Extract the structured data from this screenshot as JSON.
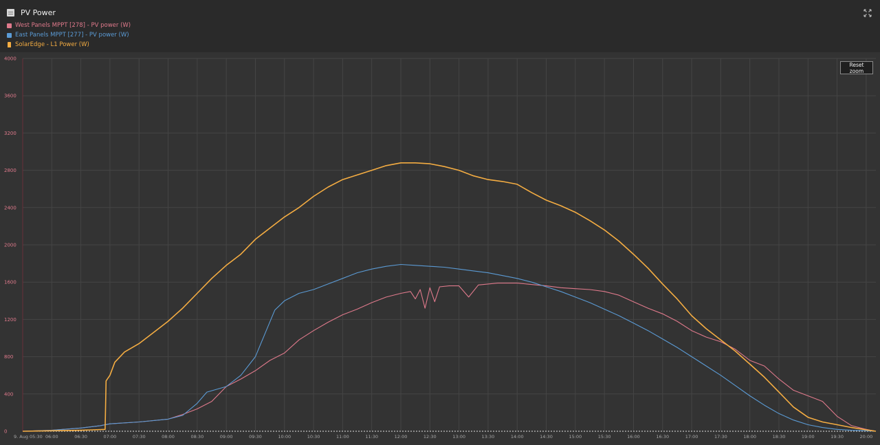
{
  "window": {
    "title": "PV Power",
    "title_icon": "chart-widget-icon",
    "expand_icon": "expand-icon"
  },
  "legend": [
    {
      "label": "West Panels MPPT [278] - PV power (W)",
      "color": "#e07a8c",
      "icon": "square"
    },
    {
      "label": "East Panels MPPT [277] - PV power (W)",
      "color": "#5b9bd5",
      "icon": "square"
    },
    {
      "label": "SolarEdge - L1 Power (W)",
      "color": "#f5ad42",
      "icon": "bottle"
    }
  ],
  "reset_zoom_label": "Reset zoom",
  "chart_data": {
    "type": "line",
    "title": "PV Power",
    "xlabel": "",
    "ylabel": "",
    "x_ticks": [
      "9. Aug 05:30",
      "06:00",
      "06:30",
      "07:00",
      "07:30",
      "08:00",
      "08:30",
      "09:00",
      "09:30",
      "10:00",
      "10:30",
      "11:00",
      "11:30",
      "12:00",
      "12:30",
      "13:00",
      "13:30",
      "14:00",
      "14:30",
      "15:00",
      "15:30",
      "16:00",
      "16:30",
      "17:00",
      "17:30",
      "18:00",
      "18:30",
      "19:00",
      "19:30",
      "20:00"
    ],
    "xlim": [
      "05:30",
      "20:10"
    ],
    "y_ticks": [
      0,
      400,
      800,
      1200,
      1600,
      2000,
      2400,
      2800,
      3200,
      3600,
      4000
    ],
    "ylim": [
      0,
      4000
    ],
    "grid": true,
    "series": [
      {
        "name": "West Panels MPPT [278] - PV power (W)",
        "color": "#e07a8c",
        "points": [
          [
            "05:30",
            0
          ],
          [
            "06:00",
            10
          ],
          [
            "06:30",
            35
          ],
          [
            "06:50",
            60
          ],
          [
            "07:00",
            80
          ],
          [
            "07:30",
            100
          ],
          [
            "08:00",
            130
          ],
          [
            "08:15",
            180
          ],
          [
            "08:30",
            240
          ],
          [
            "08:45",
            320
          ],
          [
            "09:00",
            480
          ],
          [
            "09:15",
            560
          ],
          [
            "09:30",
            650
          ],
          [
            "09:45",
            760
          ],
          [
            "10:00",
            840
          ],
          [
            "10:15",
            980
          ],
          [
            "10:30",
            1080
          ],
          [
            "10:45",
            1170
          ],
          [
            "11:00",
            1250
          ],
          [
            "11:15",
            1310
          ],
          [
            "11:30",
            1380
          ],
          [
            "11:45",
            1440
          ],
          [
            "12:00",
            1480
          ],
          [
            "12:10",
            1500
          ],
          [
            "12:15",
            1420
          ],
          [
            "12:20",
            1520
          ],
          [
            "12:25",
            1320
          ],
          [
            "12:30",
            1540
          ],
          [
            "12:35",
            1390
          ],
          [
            "12:40",
            1550
          ],
          [
            "12:50",
            1560
          ],
          [
            "13:00",
            1560
          ],
          [
            "13:10",
            1440
          ],
          [
            "13:20",
            1570
          ],
          [
            "13:30",
            1580
          ],
          [
            "13:40",
            1590
          ],
          [
            "13:50",
            1590
          ],
          [
            "14:00",
            1590
          ],
          [
            "14:10",
            1580
          ],
          [
            "14:20",
            1570
          ],
          [
            "14:30",
            1560
          ],
          [
            "14:45",
            1540
          ],
          [
            "15:00",
            1530
          ],
          [
            "15:15",
            1520
          ],
          [
            "15:30",
            1500
          ],
          [
            "15:45",
            1460
          ],
          [
            "16:00",
            1390
          ],
          [
            "16:15",
            1320
          ],
          [
            "16:30",
            1260
          ],
          [
            "16:45",
            1180
          ],
          [
            "17:00",
            1080
          ],
          [
            "17:15",
            1010
          ],
          [
            "17:30",
            960
          ],
          [
            "17:45",
            880
          ],
          [
            "18:00",
            760
          ],
          [
            "18:15",
            700
          ],
          [
            "18:30",
            560
          ],
          [
            "18:45",
            440
          ],
          [
            "19:00",
            380
          ],
          [
            "19:15",
            320
          ],
          [
            "19:30",
            160
          ],
          [
            "19:45",
            60
          ],
          [
            "20:00",
            20
          ],
          [
            "20:10",
            0
          ]
        ]
      },
      {
        "name": "East Panels MPPT [277] - PV power (W)",
        "color": "#5b9bd5",
        "points": [
          [
            "05:30",
            0
          ],
          [
            "06:00",
            10
          ],
          [
            "06:30",
            35
          ],
          [
            "06:50",
            60
          ],
          [
            "07:00",
            80
          ],
          [
            "07:30",
            100
          ],
          [
            "08:00",
            130
          ],
          [
            "08:15",
            170
          ],
          [
            "08:30",
            300
          ],
          [
            "08:40",
            420
          ],
          [
            "09:00",
            480
          ],
          [
            "09:15",
            600
          ],
          [
            "09:30",
            800
          ],
          [
            "09:40",
            1050
          ],
          [
            "09:50",
            1300
          ],
          [
            "10:00",
            1400
          ],
          [
            "10:15",
            1480
          ],
          [
            "10:30",
            1520
          ],
          [
            "10:45",
            1580
          ],
          [
            "11:00",
            1640
          ],
          [
            "11:15",
            1700
          ],
          [
            "11:30",
            1740
          ],
          [
            "11:45",
            1770
          ],
          [
            "12:00",
            1790
          ],
          [
            "12:15",
            1780
          ],
          [
            "12:30",
            1770
          ],
          [
            "12:45",
            1760
          ],
          [
            "13:00",
            1740
          ],
          [
            "13:15",
            1720
          ],
          [
            "13:30",
            1700
          ],
          [
            "13:45",
            1670
          ],
          [
            "14:00",
            1640
          ],
          [
            "14:15",
            1600
          ],
          [
            "14:30",
            1550
          ],
          [
            "14:45",
            1500
          ],
          [
            "15:00",
            1440
          ],
          [
            "15:15",
            1380
          ],
          [
            "15:30",
            1310
          ],
          [
            "15:45",
            1240
          ],
          [
            "16:00",
            1160
          ],
          [
            "16:15",
            1080
          ],
          [
            "16:30",
            990
          ],
          [
            "16:45",
            900
          ],
          [
            "17:00",
            800
          ],
          [
            "17:15",
            700
          ],
          [
            "17:30",
            600
          ],
          [
            "17:45",
            490
          ],
          [
            "18:00",
            380
          ],
          [
            "18:15",
            280
          ],
          [
            "18:30",
            190
          ],
          [
            "18:45",
            120
          ],
          [
            "19:00",
            70
          ],
          [
            "19:15",
            40
          ],
          [
            "19:30",
            20
          ],
          [
            "19:45",
            10
          ],
          [
            "20:00",
            5
          ],
          [
            "20:10",
            0
          ]
        ]
      },
      {
        "name": "SolarEdge - L1 Power (W)",
        "color": "#f5ad42",
        "points": [
          [
            "05:30",
            0
          ],
          [
            "06:00",
            5
          ],
          [
            "06:30",
            10
          ],
          [
            "06:55",
            20
          ],
          [
            "06:56",
            540
          ],
          [
            "07:00",
            600
          ],
          [
            "07:05",
            740
          ],
          [
            "07:15",
            850
          ],
          [
            "07:30",
            940
          ],
          [
            "07:45",
            1060
          ],
          [
            "08:00",
            1180
          ],
          [
            "08:15",
            1320
          ],
          [
            "08:30",
            1480
          ],
          [
            "08:45",
            1640
          ],
          [
            "09:00",
            1780
          ],
          [
            "09:15",
            1900
          ],
          [
            "09:30",
            2060
          ],
          [
            "09:45",
            2180
          ],
          [
            "10:00",
            2300
          ],
          [
            "10:15",
            2400
          ],
          [
            "10:30",
            2520
          ],
          [
            "10:45",
            2620
          ],
          [
            "11:00",
            2700
          ],
          [
            "11:15",
            2750
          ],
          [
            "11:30",
            2800
          ],
          [
            "11:45",
            2850
          ],
          [
            "12:00",
            2880
          ],
          [
            "12:15",
            2880
          ],
          [
            "12:30",
            2870
          ],
          [
            "12:45",
            2840
          ],
          [
            "13:00",
            2800
          ],
          [
            "13:15",
            2740
          ],
          [
            "13:30",
            2700
          ],
          [
            "13:45",
            2680
          ],
          [
            "14:00",
            2650
          ],
          [
            "14:15",
            2560
          ],
          [
            "14:30",
            2480
          ],
          [
            "14:45",
            2420
          ],
          [
            "15:00",
            2350
          ],
          [
            "15:15",
            2260
          ],
          [
            "15:30",
            2160
          ],
          [
            "15:45",
            2040
          ],
          [
            "16:00",
            1900
          ],
          [
            "16:15",
            1750
          ],
          [
            "16:30",
            1580
          ],
          [
            "16:45",
            1420
          ],
          [
            "17:00",
            1240
          ],
          [
            "17:15",
            1100
          ],
          [
            "17:30",
            980
          ],
          [
            "17:45",
            860
          ],
          [
            "18:00",
            720
          ],
          [
            "18:15",
            580
          ],
          [
            "18:30",
            420
          ],
          [
            "18:45",
            260
          ],
          [
            "19:00",
            150
          ],
          [
            "19:15",
            100
          ],
          [
            "19:30",
            70
          ],
          [
            "19:45",
            40
          ],
          [
            "20:00",
            15
          ],
          [
            "20:10",
            0
          ]
        ]
      }
    ]
  }
}
